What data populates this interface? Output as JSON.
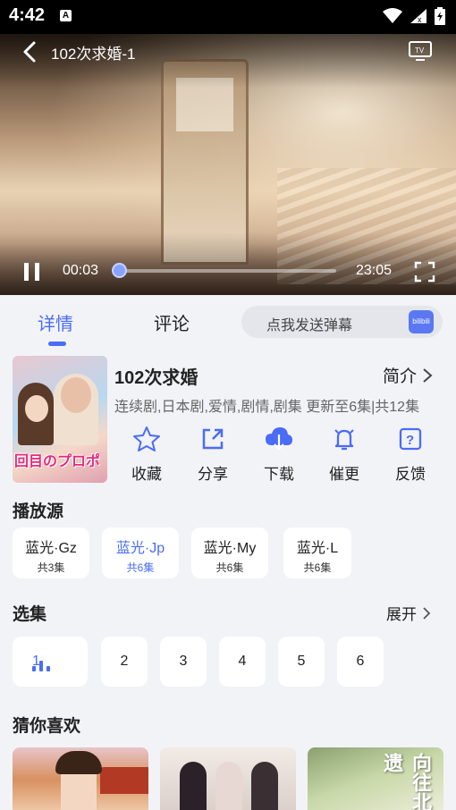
{
  "status_bar": {
    "time": "4:42",
    "notification_icon": "A"
  },
  "player": {
    "title": "102次求婚-1",
    "current_time": "00:03",
    "total_time": "23:05",
    "progress": 0.002
  },
  "tabs": [
    {
      "label": "详情",
      "active": true
    },
    {
      "label": "评论",
      "active": false
    }
  ],
  "danmu": {
    "placeholder": "点我发送弹幕",
    "icon_label": "bilibili"
  },
  "show": {
    "title": "102次求婚",
    "intro_label": "简介",
    "meta": "连续剧,日本剧,爱情,剧情,剧集 更新至6集|共12集",
    "poster_text": "回目のプロポ"
  },
  "actions": [
    {
      "label": "收藏",
      "icon": "star-icon"
    },
    {
      "label": "分享",
      "icon": "share-icon"
    },
    {
      "label": "下载",
      "icon": "cloud-download-icon"
    },
    {
      "label": "催更",
      "icon": "bell-icon"
    },
    {
      "label": "反馈",
      "icon": "question-icon"
    }
  ],
  "sources_title": "播放源",
  "sources": [
    {
      "name": "蓝光·Gz",
      "count": "共3集",
      "active": false
    },
    {
      "name": "蓝光·Jp",
      "count": "共6集",
      "active": true
    },
    {
      "name": "蓝光·My",
      "count": "共6集",
      "active": false
    },
    {
      "name": "蓝光·L",
      "count": "共6集",
      "active": false
    }
  ],
  "episodes_title": "选集",
  "expand_label": "展开",
  "episodes": [
    "1",
    "2",
    "3",
    "4",
    "5",
    "6"
  ],
  "current_episode": "1",
  "recommend_title": "猜你喜欢",
  "recommendations": [
    {
      "poster_text": ""
    },
    {
      "poster_text": ""
    },
    {
      "poster_text": "向往北遗"
    }
  ],
  "colors": {
    "accent": "#4a6cf7",
    "background": "#f2f3f7"
  }
}
